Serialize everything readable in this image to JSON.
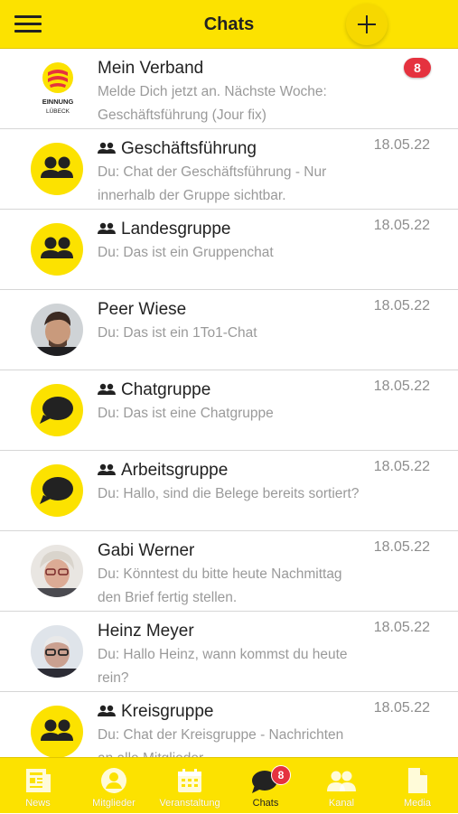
{
  "header": {
    "title": "Chats"
  },
  "chats": [
    {
      "name": "Mein Verband",
      "preview": "Melde Dich jetzt an. Nächste Woche: Geschäftsführung (Jour fix)",
      "date": "",
      "badge": "8",
      "logo_text": "EINNUNG LÜBECK"
    },
    {
      "name": "Geschäftsführung",
      "preview": "Du: Chat der Geschäftsführung - Nur innerhalb der Gruppe sichtbar.",
      "date": "18.05.22"
    },
    {
      "name": "Landesgruppe",
      "preview": "Du: Das ist ein Gruppenchat",
      "date": "18.05.22"
    },
    {
      "name": "Peer Wiese",
      "preview": "Du: Das ist ein 1To1-Chat",
      "date": "18.05.22"
    },
    {
      "name": "Chatgruppe",
      "preview": "Du: Das ist eine Chatgruppe",
      "date": "18.05.22"
    },
    {
      "name": "Arbeitsgruppe",
      "preview": "Du: Hallo, sind die Belege bereits sortiert?",
      "date": "18.05.22"
    },
    {
      "name": "Gabi Werner",
      "preview": "Du: Könntest du bitte heute Nachmittag den Brief fertig stellen.",
      "date": "18.05.22"
    },
    {
      "name": "Heinz Meyer",
      "preview": "Du: Hallo Heinz, wann kommst du heute rein?",
      "date": "18.05.22"
    },
    {
      "name": "Kreisgruppe",
      "preview": "Du: Chat der Kreisgruppe - Nachrichten an alle Mitglieder",
      "date": "18.05.22"
    }
  ],
  "tabs": [
    {
      "label": "News",
      "icon": "newspaper-icon"
    },
    {
      "label": "Mitglieder",
      "icon": "user-icon"
    },
    {
      "label": "Veranstaltung",
      "icon": "calendar-icon"
    },
    {
      "label": "Chats",
      "icon": "chat-icon",
      "badge": "8",
      "active": true
    },
    {
      "label": "Kanal",
      "icon": "group-icon"
    },
    {
      "label": "Media",
      "icon": "document-icon"
    }
  ],
  "colors": {
    "brand_yellow": "#fce200",
    "badge_red": "#e5323f",
    "preview_gray": "#9a9a9a"
  }
}
